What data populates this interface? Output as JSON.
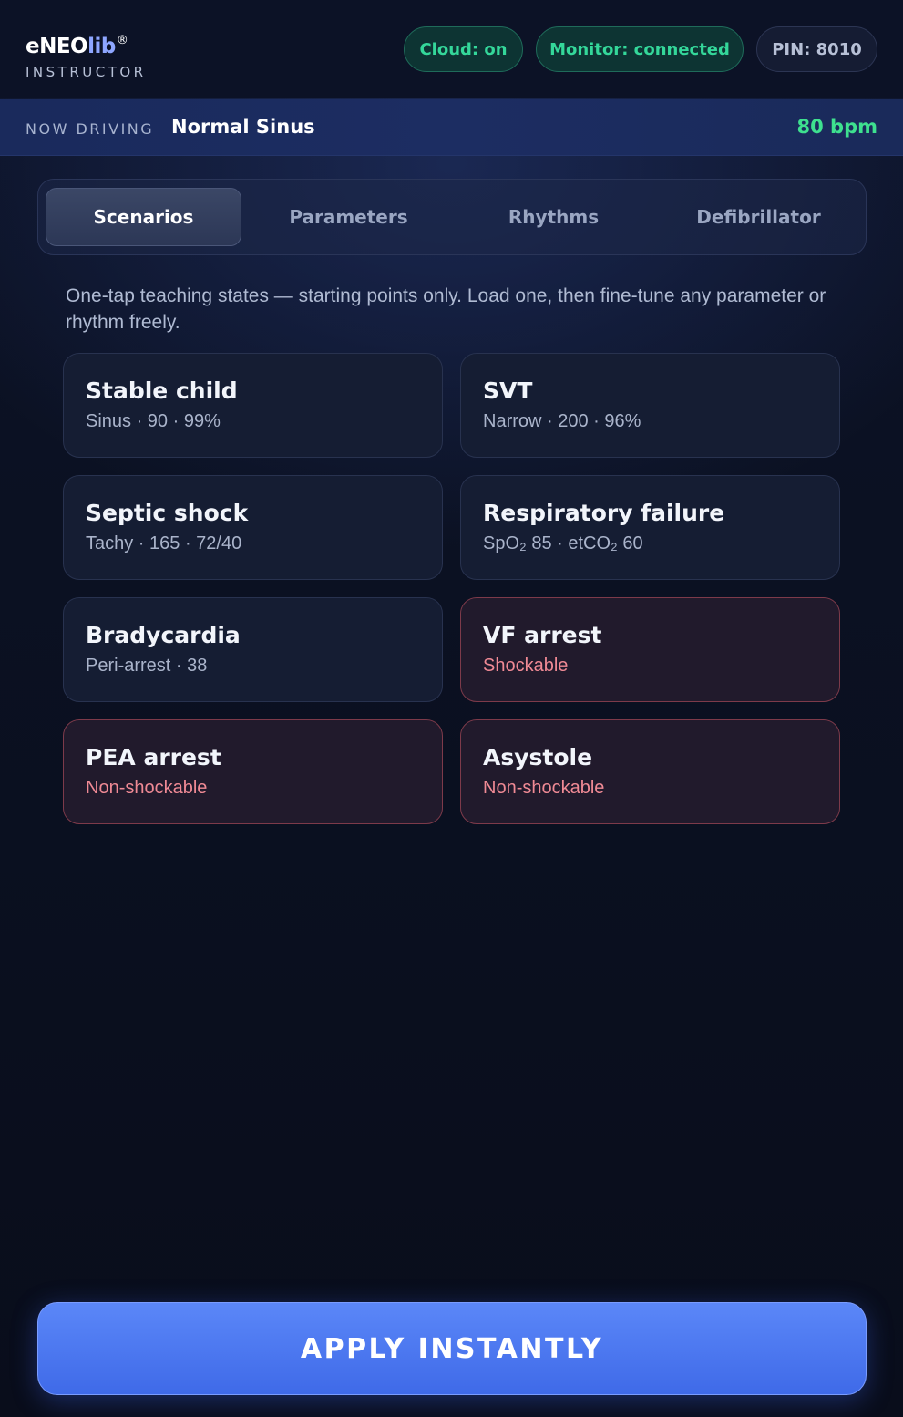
{
  "brand": {
    "name_prefix": "eNEO",
    "name_accent": "lib",
    "registered": "®",
    "subtitle": "INSTRUCTOR"
  },
  "status": {
    "cloud": "Cloud: on",
    "monitor": "Monitor: connected",
    "pin": "PIN: 8010"
  },
  "now_driving": {
    "label": "NOW DRIVING",
    "rhythm": "Normal Sinus",
    "rate": "80 bpm"
  },
  "tabs": [
    {
      "label": "Scenarios",
      "active": true
    },
    {
      "label": "Parameters",
      "active": false
    },
    {
      "label": "Rhythms",
      "active": false
    },
    {
      "label": "Defibrillator",
      "active": false
    }
  ],
  "intro": "One-tap teaching states — starting points only. Load one, then fine-tune any parameter or rhythm freely.",
  "scenarios": [
    {
      "title": "Stable child",
      "subtitle": "Sinus · 90 · 99%",
      "danger": false
    },
    {
      "title": "SVT",
      "subtitle": "Narrow · 200 · 96%",
      "danger": false
    },
    {
      "title": "Septic shock",
      "subtitle": "Tachy · 165 · 72/40",
      "danger": false
    },
    {
      "title": "Respiratory failure",
      "subtitle": "SpO₂ 85 · etCO₂ 60",
      "danger": false
    },
    {
      "title": "Bradycardia",
      "subtitle": "Peri-arrest · 38",
      "danger": false
    },
    {
      "title": "VF arrest",
      "subtitle": "Shockable",
      "danger": true
    },
    {
      "title": "PEA arrest",
      "subtitle": "Non-shockable",
      "danger": true
    },
    {
      "title": "Asystole",
      "subtitle": "Non-shockable",
      "danger": true
    }
  ],
  "apply_label": "APPLY INSTANTLY",
  "colors": {
    "accent": "#4f7bf2",
    "ok": "#34d79a",
    "bpm": "#3ee08f",
    "danger": "#f08a95"
  }
}
